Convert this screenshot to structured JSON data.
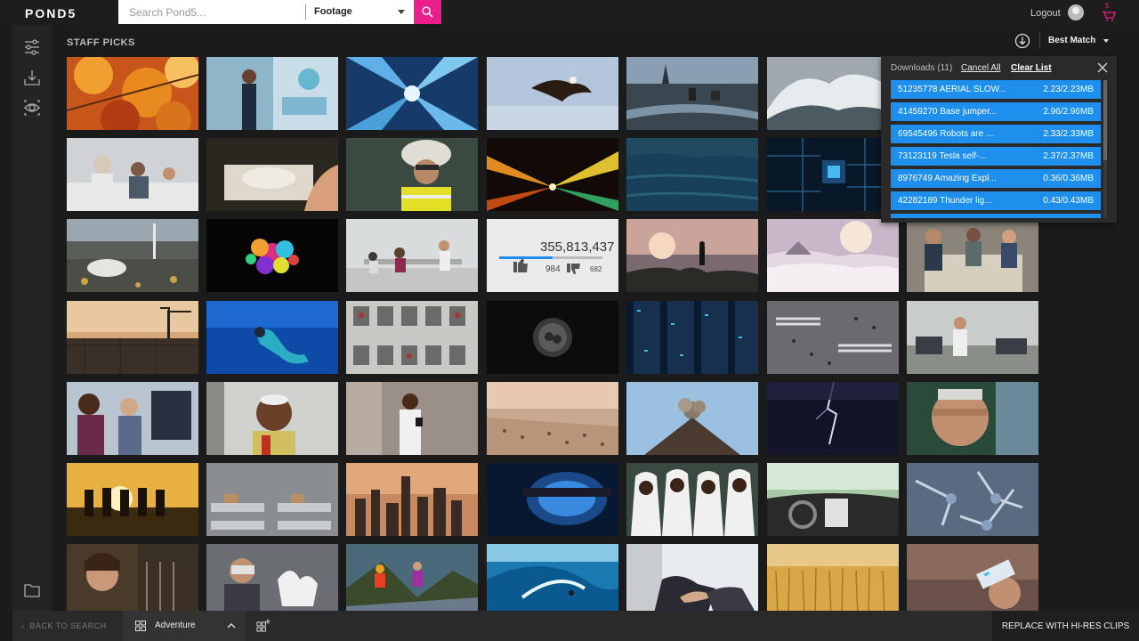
{
  "header": {
    "logo": "POND5",
    "search_placeholder": "Search Pond5...",
    "search_type": "Footage",
    "logout_label": "Logout",
    "cart_count": "5"
  },
  "left_rail": {
    "icons": [
      "filters-icon",
      "download-icon",
      "preview-icon",
      "folder-icon"
    ]
  },
  "main": {
    "section_title": "STAFF PICKS",
    "sort_label": "Best Match"
  },
  "downloads": {
    "heading": "Downloads (11)",
    "cancel_all": "Cancel All",
    "clear_list": "Clear List",
    "items": [
      {
        "name": "51235778 AERIAL SLOW...",
        "size": "2.23/2.23MB"
      },
      {
        "name": "41459270 Base jumper...",
        "size": "2.96/2.96MB"
      },
      {
        "name": "69545496 Robots are ...",
        "size": "2.33/2.33MB"
      },
      {
        "name": "73123119 Tesla self-...",
        "size": "2.37/2.37MB"
      },
      {
        "name": "8976749 Amazing Expl...",
        "size": "0.36/0.36MB"
      },
      {
        "name": "42282189 Thunder lig...",
        "size": "0.43/0.43MB"
      }
    ]
  },
  "thumbnails": {
    "video3_count": "355,813,437",
    "video3_likes": "984",
    "video3_dislikes": "682"
  },
  "footer": {
    "back_to_search": "BACK TO SEARCH",
    "folder_label": "Adventure",
    "replace_button": "REPLACE WITH HI-RES CLIPS"
  },
  "colors": {
    "brand": "#ea1e8d",
    "download_row": "#1e8fec"
  }
}
